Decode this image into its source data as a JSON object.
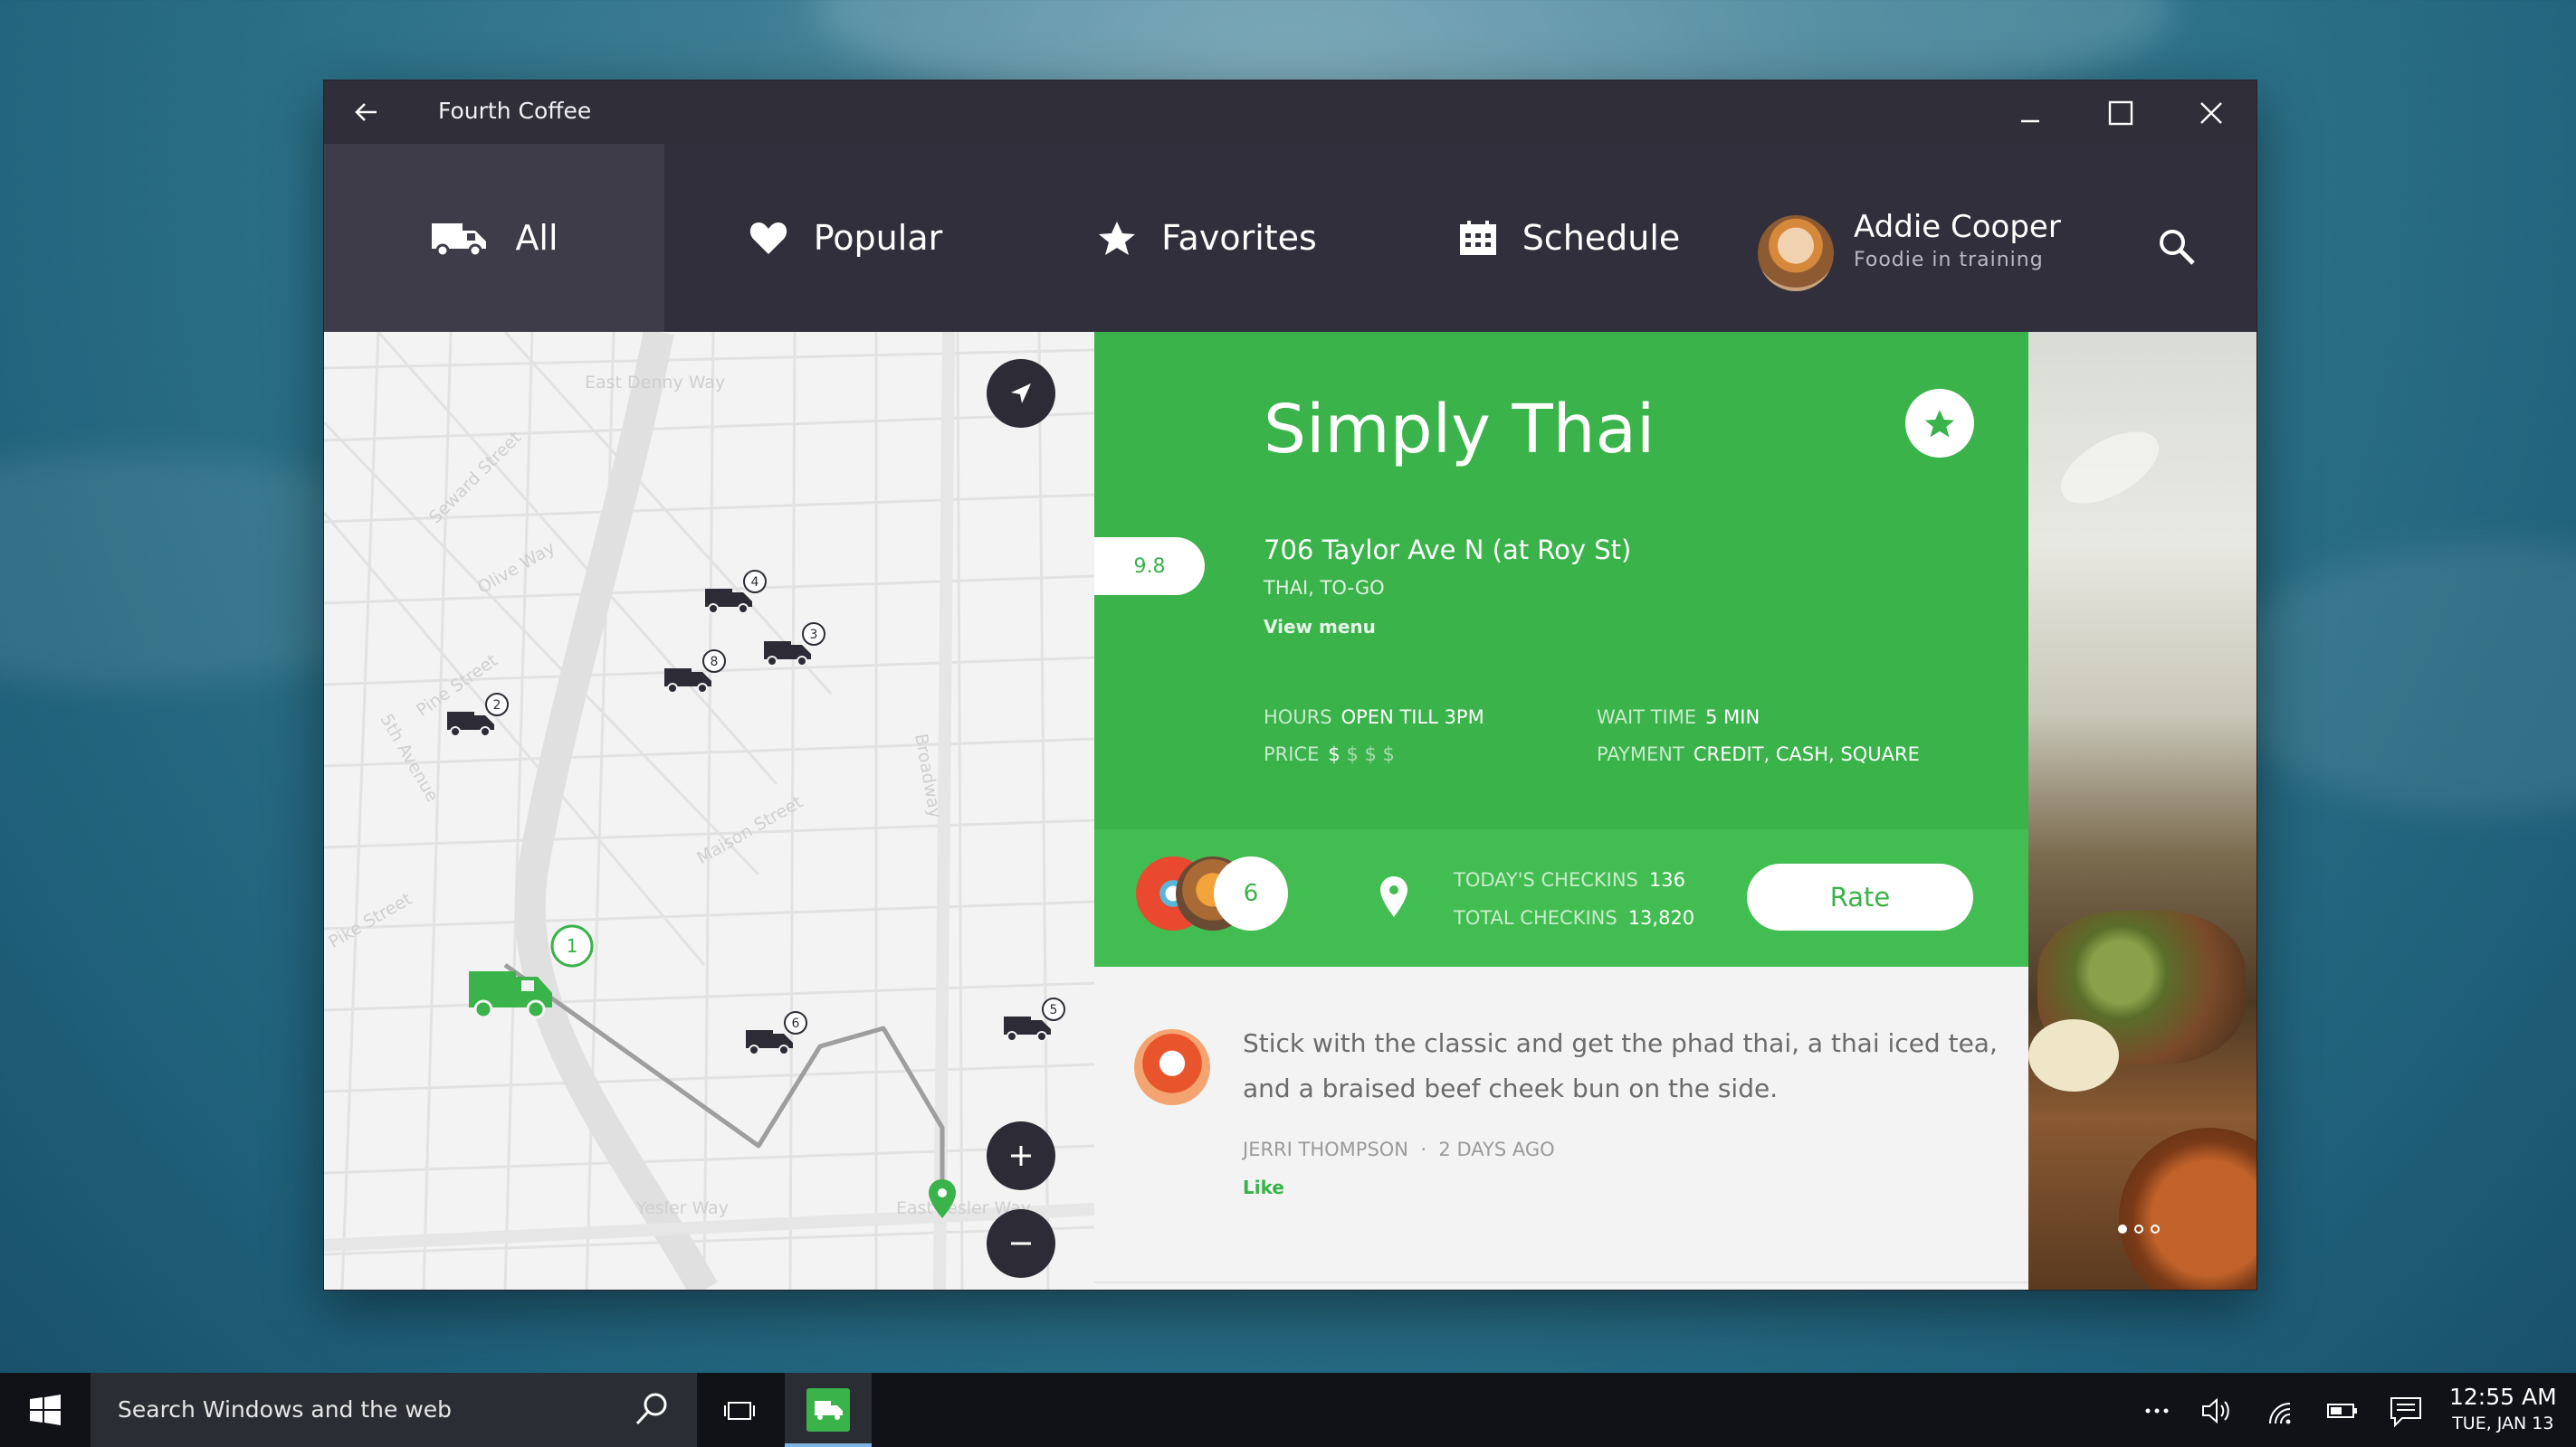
{
  "window": {
    "title": "Fourth Coffee"
  },
  "nav": {
    "tabs": [
      {
        "label": "All",
        "icon": "truck-icon",
        "active": true
      },
      {
        "label": "Popular",
        "icon": "heart-icon"
      },
      {
        "label": "Favorites",
        "icon": "star-icon"
      },
      {
        "label": "Schedule",
        "icon": "calendar-icon"
      }
    ],
    "user": {
      "name": "Addie Cooper",
      "subtitle": "Foodie in training"
    }
  },
  "map": {
    "labels": [
      "East Denny Way",
      "Seward Street",
      "Olive Way",
      "Pine Street",
      "5th Avenue",
      "Maison Street",
      "Broadway",
      "Pike Street",
      "Yesler Way",
      "East Yesler Way"
    ],
    "markers": [
      "4",
      "3",
      "8",
      "2",
      "1",
      "6",
      "5"
    ]
  },
  "detail": {
    "name": "Simply Thai",
    "score": "9.8",
    "address": "706 Taylor Ave N (at Roy St)",
    "cuisine": "THAI, TO-GO",
    "view_menu": "View menu",
    "hours_label": "HOURS",
    "hours_value": "OPEN TILL 3PM",
    "wait_label": "WAIT TIME",
    "wait_value": "5 MIN",
    "price_label": "PRICE",
    "price_value": "$ $ $ $",
    "price_level": 1,
    "payment_label": "PAYMENT",
    "payment_value": "CREDIT, CASH, SQUARE"
  },
  "checkins": {
    "count": "6",
    "today_label": "TODAY'S CHECKINS",
    "today_value": "136",
    "total_label": "TOTAL CHECKINS",
    "total_value": "13,820",
    "rate_label": "Rate"
  },
  "review": {
    "text": "Stick with the classic and get the phad thai, a thai iced tea, and a braised beef cheek bun on the side.",
    "author": "JERRI THOMPSON",
    "time": "2 DAYS AGO",
    "like_label": "Like"
  },
  "taskbar": {
    "search_placeholder": "Search Windows and the web",
    "time": "12:55 AM",
    "date": "TUE, JAN 13"
  },
  "colors": {
    "accent": "#3ab34a",
    "titlebar": "#2f2e39",
    "nav": "#312f3b"
  }
}
